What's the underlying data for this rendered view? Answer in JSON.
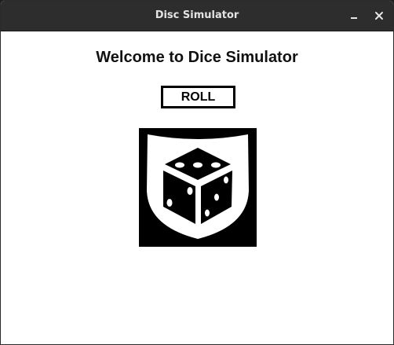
{
  "window": {
    "title": "Disc Simulator",
    "controls": {
      "minimize_icon": "minimize-icon",
      "close_icon": "close-icon"
    }
  },
  "main": {
    "heading": "Welcome to Dice Simulator",
    "roll_button_label": "ROLL",
    "dice_image_icon": "dice-shield-icon"
  },
  "colors": {
    "titlebar_bg": "#2d2d2d",
    "content_bg": "#ffffff",
    "text": "#111111",
    "button_border": "#000000"
  }
}
